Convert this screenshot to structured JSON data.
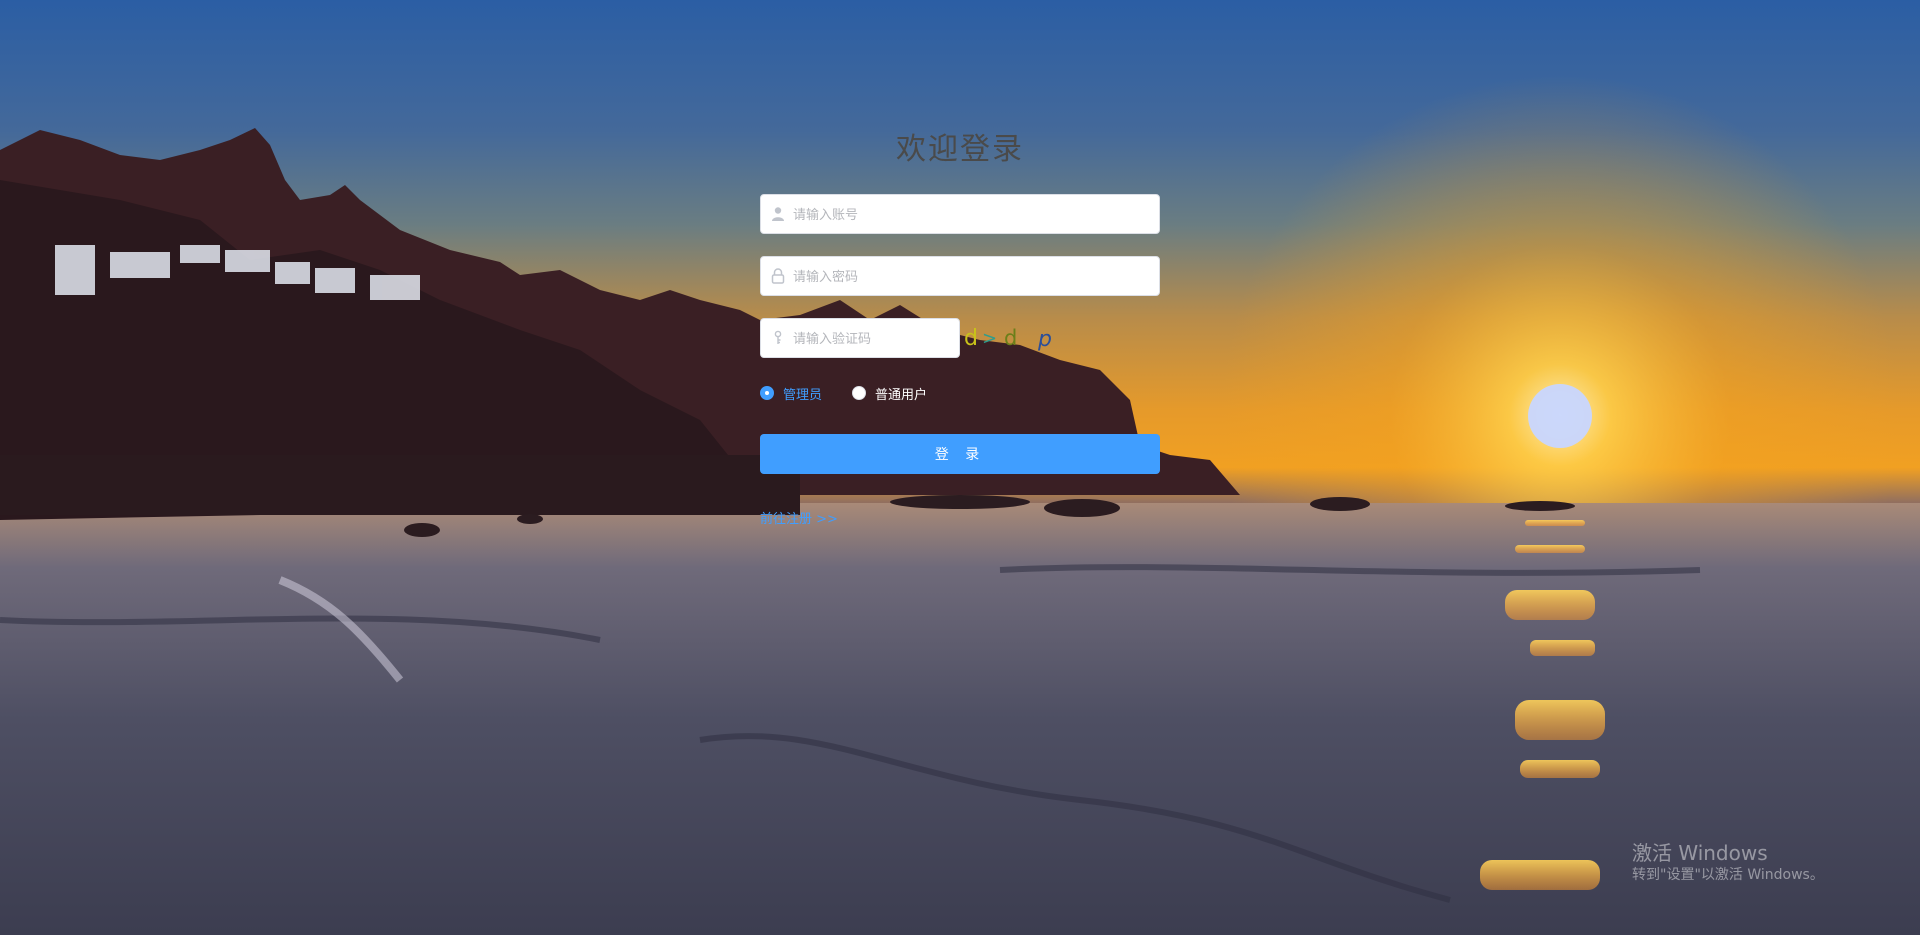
{
  "login": {
    "title": "欢迎登录",
    "username_placeholder": "请输入账号",
    "password_placeholder": "请输入密码",
    "captcha_placeholder": "请输入验证码",
    "captcha_chars": [
      "d",
      ">",
      "d",
      "p"
    ],
    "captcha_colors": [
      "#c9c21a",
      "#2f9c8c",
      "#6b7f1a",
      "#2b4f9a"
    ],
    "roles": [
      {
        "label": "管理员",
        "selected": true
      },
      {
        "label": "普通用户",
        "selected": false
      }
    ],
    "submit_label": "登 录",
    "register_link": "前往注册 >>"
  },
  "watermark": {
    "line1": "激活 Windows",
    "line2": "转到\"设置\"以激活 Windows。"
  },
  "colors": {
    "accent": "#409eff",
    "title": "#4a4a4a"
  },
  "icons": {
    "username": "user-icon",
    "password": "lock-icon",
    "captcha": "key-icon"
  }
}
